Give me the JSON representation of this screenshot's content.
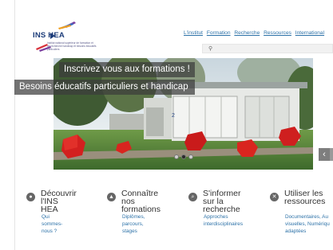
{
  "header": {
    "logo_text": "INS HEA",
    "logo_subtitle": "Institut national supérieur de formation et de recherche handicap et besoins éducatifs particuliers",
    "nav": [
      "L'institut",
      "Formation",
      "Recherche",
      "Ressources",
      "International"
    ],
    "search_placeholder": ""
  },
  "slider": {
    "caption_title": "Inscrivez vous aux formations !",
    "caption_subtitle": "Besoins éducatifs particuliers et handicap",
    "building_number": "2",
    "active_dot": 2,
    "dot_count": 3,
    "next_arrow": "‹"
  },
  "features": [
    {
      "icon": "info-icon",
      "glyph": "●",
      "title": "Découvrir\nl'INS HEA",
      "sub": "Qui sommes-nous ?"
    },
    {
      "icon": "person-icon",
      "glyph": "▲",
      "title": "Connaître nos\nformations",
      "sub": "Diplômes, parcours,\nstages"
    },
    {
      "icon": "search-icon",
      "glyph": "⌕",
      "title": "S'informer sur la\nrecherche",
      "sub": "Approches\ninterdisciplinaires"
    },
    {
      "icon": "tools-icon",
      "glyph": "✕",
      "title": "Utiliser les\nressources",
      "sub": "Documentaires, Au\nvisuelles, Numériqu\nadaptées"
    }
  ],
  "colors": {
    "link": "#2d72a8",
    "logo": "#1d3d7a",
    "accent_red": "#d11a1a"
  }
}
